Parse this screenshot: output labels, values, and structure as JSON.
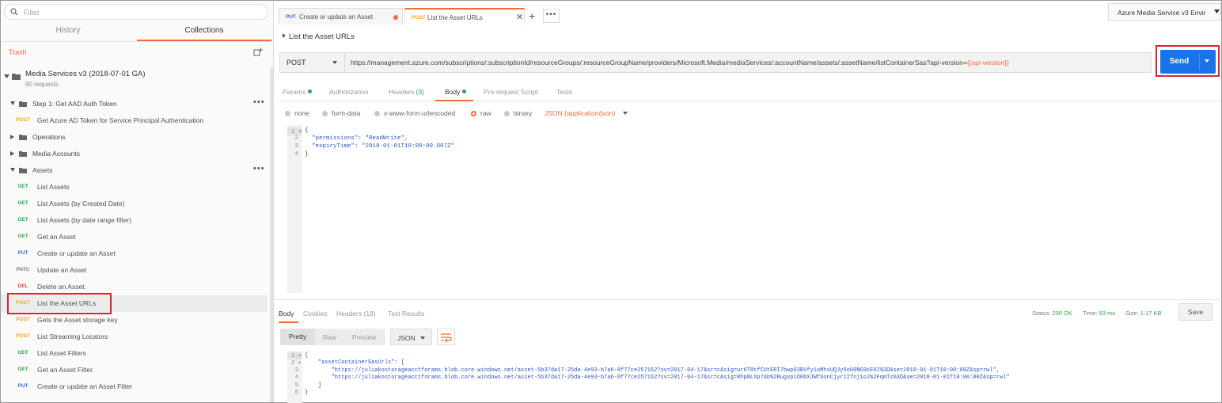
{
  "sidebar": {
    "filter_placeholder": "Filter",
    "tabs": [
      "History",
      "Collections"
    ],
    "trash_label": "Trash",
    "collection": {
      "name": "Media Services v3 (2018-07-01 GA)",
      "count": "90 requests"
    },
    "items": [
      {
        "kind": "folder",
        "label": "Step 1: Get AAD Auth Token",
        "open": true,
        "more": "•••"
      },
      {
        "kind": "req",
        "method": "POST",
        "label": "Get Azure AD Token for Service Principal Authentication"
      },
      {
        "kind": "folder",
        "label": "Operations",
        "open": false
      },
      {
        "kind": "folder",
        "label": "Media Accounts",
        "open": false
      },
      {
        "kind": "folder",
        "label": "Assets",
        "open": true,
        "more": "•••"
      },
      {
        "kind": "req",
        "method": "GET",
        "label": "List Assets"
      },
      {
        "kind": "req",
        "method": "GET",
        "label": "List Assets (by Created Date)"
      },
      {
        "kind": "req",
        "method": "GET",
        "label": "List Assets (by date range filter)"
      },
      {
        "kind": "req",
        "method": "GET",
        "label": "Get an Asset"
      },
      {
        "kind": "req",
        "method": "PUT",
        "label": "Create or update an Asset"
      },
      {
        "kind": "req",
        "method": "PATC",
        "label": "Update an Asset"
      },
      {
        "kind": "req",
        "method": "DEL",
        "label": "Delete an Asset."
      },
      {
        "kind": "req",
        "method": "POST",
        "label": "List the Asset URLs",
        "active": true
      },
      {
        "kind": "req",
        "method": "POST",
        "label": "Gets the Asset storage key"
      },
      {
        "kind": "req",
        "method": "POST",
        "label": "List Streaming Locators"
      },
      {
        "kind": "req",
        "method": "GET",
        "label": "List Asset Filters"
      },
      {
        "kind": "req",
        "method": "GET",
        "label": "Get an Asset Filter."
      },
      {
        "kind": "req",
        "method": "PUT",
        "label": "Create or update an Asset Filter"
      }
    ]
  },
  "tabs": [
    {
      "method": "PUT",
      "label": "Create or update an Asset"
    },
    {
      "method": "POST",
      "label": "List the Asset URLs"
    }
  ],
  "tab_more": "•••",
  "environment": "Azure Media Service v3 Envir",
  "breadcrumb": "List the Asset URLs",
  "request": {
    "method": "POST",
    "url_prefix": "https://management.azure.com/subscriptions/:subscriptionId/resourceGroups/:resourceGroupName/providers/Microsoft.Media/mediaServices/:accountName/assets/:assetName/listContainerSas?api-version=",
    "url_var": "{{api-version}}",
    "send_label": "Send"
  },
  "request_tabs": {
    "params": "Params",
    "authorization": "Authorization",
    "headers": "Headers",
    "headers_count": "(3)",
    "body": "Body",
    "prerequest": "Pre-request Script",
    "tests": "Tests"
  },
  "body_options": {
    "none": "none",
    "formdata": "form-data",
    "urlencoded": "x-www-form-urlencoded",
    "raw": "raw",
    "binary": "binary",
    "content_type": "JSON (application/json)"
  },
  "request_body": {
    "line_numbers": [
      "1",
      "2",
      "3",
      "4"
    ],
    "lines": [
      "{",
      "  \"permissions\": \"ReadWrite\",",
      "  \"expiryTime\": \"2018-01-01T10:00:00.007Z\"",
      "}"
    ]
  },
  "response": {
    "tabs": {
      "body": "Body",
      "cookies": "Cookies",
      "headers": "Headers (18)",
      "tests": "Test Results"
    },
    "status_label": "Status:",
    "status_value": "200 OK",
    "time_label": "Time:",
    "time_value": "93 ms",
    "size_label": "Size:",
    "size_value": "1.17 KB",
    "save_label": "Save",
    "formats": {
      "pretty": "Pretty",
      "raw": "Raw",
      "preview": "Preview",
      "json": "JSON"
    },
    "line_numbers": [
      "1",
      "2",
      "3",
      "4",
      "5",
      "6"
    ],
    "lines": [
      "{",
      "    \"assetContainerSasUrls\": [",
      "        \"https://juliakostorageacctforams.blob.core.windows.net/asset-5b37da17-25da-4e93-b7a6-8f77ce257162?sv=2017-04-17&sr=c&sig=ur6T8tfCUtERI7bwp03BVfy1oMhxUQJy5o00NG9kE0I%3D&se=2018-01-01T10:00:00Z&sp=rwl\",",
      "        \"https://juliakostorageacctforams.blob.core.windows.net/asset-5b37da17-25da-4e93-b7a6-8f77ce257162?sv=2017-04-17&sr=c&sig=RhpNLXp7Ab%2BugvpiO0bXJWfUonCjyr1ITnjioJ%2FqmTs%3D&se=2018-01-01T10:00:00Z&sp=rwl\"",
      "    ]",
      "}"
    ]
  }
}
